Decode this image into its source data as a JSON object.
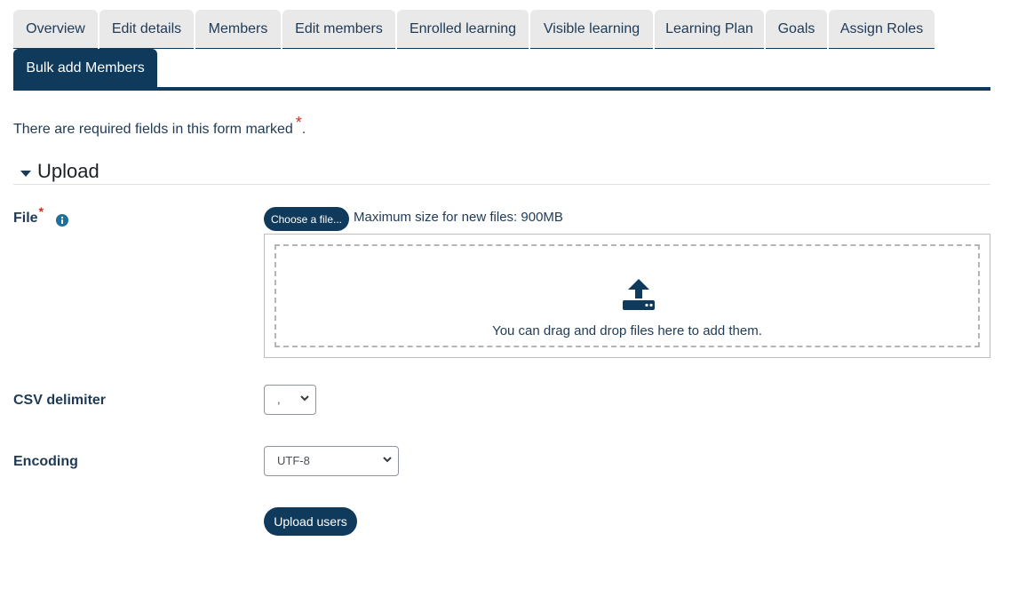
{
  "tabs_row1": [
    "Overview",
    "Edit details",
    "Members",
    "Edit members",
    "Enrolled learning",
    "Visible learning",
    "Learning Plan",
    "Goals",
    "Assign Roles"
  ],
  "tabs_row2": [
    "Bulk add Members"
  ],
  "active_tab": "Bulk add Members",
  "required_note": {
    "text": "There are required fields in this form marked",
    "star": "*",
    "period": "."
  },
  "section": {
    "title": "Upload"
  },
  "file_field": {
    "label": "File",
    "required_star": "*",
    "choose_button": "Choose a file...",
    "max_size": "Maximum size for new files: 900MB",
    "drop_text": "You can drag and drop files here to add them."
  },
  "csv_delimiter": {
    "label": "CSV delimiter",
    "selected": ","
  },
  "encoding": {
    "label": "Encoding",
    "selected": "UTF-8"
  },
  "upload_button": "Upload users",
  "colors": {
    "brand": "#0f3a5c",
    "required": "#ca3120",
    "info": "#1f6f9a"
  },
  "icons": [
    "info-icon",
    "upload-icon",
    "caret-down-icon",
    "chevron-down-icon"
  ]
}
